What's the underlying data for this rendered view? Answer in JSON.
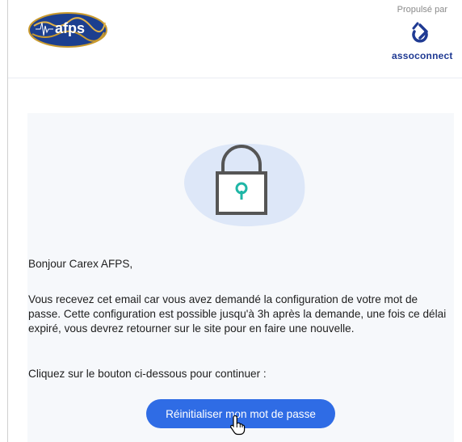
{
  "header": {
    "logo_text": "afps",
    "powered_by": "Propulsé par",
    "brand": "assoconnect"
  },
  "email": {
    "greeting": "Bonjour Carex AFPS,",
    "body": "Vous recevez cet email car vous avez demandé la configuration de votre mot de passe. Cette configuration est possible jusqu'à 3h après la demande, une fois ce délai expiré, vous devrez retourner sur le site pour en faire une nouvelle.",
    "cta_intro": "Cliquez sur le bouton ci-dessous pour continuer :",
    "button_label": "Réinitialiser mon mot de passe"
  },
  "colors": {
    "button": "#2f6ce5",
    "brand": "#1f3a93",
    "keyhole": "#1fb6a6",
    "panel": "#f6f8fb"
  }
}
